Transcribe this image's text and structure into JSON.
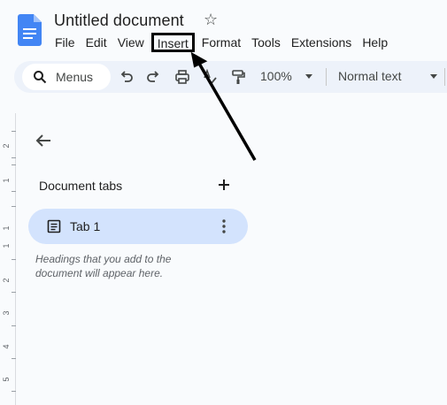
{
  "document": {
    "title": "Untitled document"
  },
  "menubar": [
    "File",
    "Edit",
    "View",
    "Insert",
    "Format",
    "Tools",
    "Extensions",
    "Help"
  ],
  "toolbar": {
    "search_label": "Menus",
    "zoom": "100%",
    "paragraph_style": "Normal text",
    "icons": [
      "search-icon",
      "undo-icon",
      "redo-icon",
      "print-icon",
      "spellcheck-icon",
      "paint-format-icon"
    ]
  },
  "ruler": {
    "labels": [
      "2",
      "1",
      "1",
      "1",
      "2",
      "3",
      "4",
      "5"
    ]
  },
  "outline_panel": {
    "section_title": "Document tabs",
    "tabs": [
      {
        "label": "Tab 1"
      }
    ],
    "hint": "Headings that you add to the document will appear here."
  },
  "annotation": {
    "highlighted_menu_item": "Insert",
    "color": "#000000"
  },
  "colors": {
    "doc_blue": "#4285f4",
    "toolbar_bg": "#edf2fa",
    "tab_selected_bg": "#d3e3fd"
  }
}
